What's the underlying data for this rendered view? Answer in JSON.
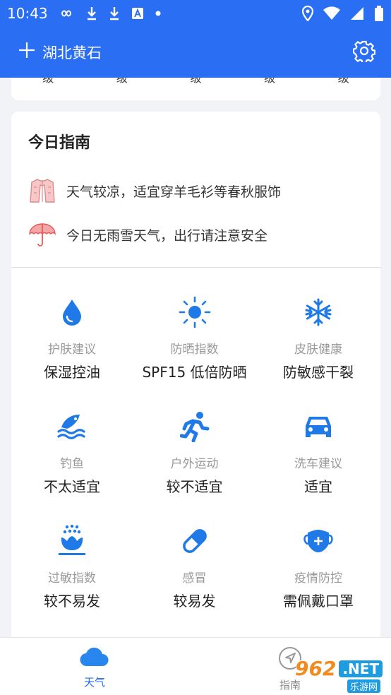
{
  "status_bar": {
    "time": "10:43",
    "icons": [
      "infinity-icon",
      "download-icon",
      "download-icon",
      "translate-icon",
      "dot-icon",
      "location-icon",
      "wifi-icon",
      "signal-icon",
      "battery-icon"
    ]
  },
  "app_bar": {
    "add_icon": "plus-icon",
    "city": "湖北黄石",
    "settings_icon": "gear-icon"
  },
  "prev_card": {
    "fragments": [
      "级",
      "级",
      "级",
      "级",
      "级"
    ]
  },
  "guide": {
    "title": "今日指南",
    "tips": [
      {
        "icon": "jacket-icon",
        "text": "天气较凉，适宜穿羊毛衫等春秋服饰"
      },
      {
        "icon": "umbrella-icon",
        "text": "今日无雨雪天气，出行请注意安全"
      }
    ],
    "items": [
      {
        "icon": "water-drop-icon",
        "label": "护肤建议",
        "value": "保湿控油"
      },
      {
        "icon": "sun-icon",
        "label": "防晒指数",
        "value": "SPF15 低倍防晒"
      },
      {
        "icon": "snowflake-icon",
        "label": "皮肤健康",
        "value": "防敏感干裂"
      },
      {
        "icon": "fish-icon",
        "label": "钓鱼",
        "value": "不太适宜"
      },
      {
        "icon": "running-icon",
        "label": "户外运动",
        "value": "较不适宜"
      },
      {
        "icon": "car-icon",
        "label": "洗车建议",
        "value": "适宜"
      },
      {
        "icon": "allergy-flower-icon",
        "label": "过敏指数",
        "value": "较不易发"
      },
      {
        "icon": "pill-icon",
        "label": "感冒",
        "value": "较易发"
      },
      {
        "icon": "mask-icon",
        "label": "疫情防控",
        "value": "需佩戴口罩"
      }
    ]
  },
  "bottom_nav": {
    "items": [
      {
        "icon": "cloud-icon",
        "label": "天气",
        "active": true
      },
      {
        "icon": "compass-icon",
        "label": "指南",
        "active": false
      }
    ]
  },
  "watermark": {
    "number": "962",
    "suffix": ".NET",
    "sub": "乐游网"
  },
  "colors": {
    "accent": "#2a6ef3",
    "icon_blue": "#1f7ae8",
    "label_gray": "#999999",
    "jacket_pink": "#f4b8b8",
    "umbrella_red": "#e85a5a"
  }
}
